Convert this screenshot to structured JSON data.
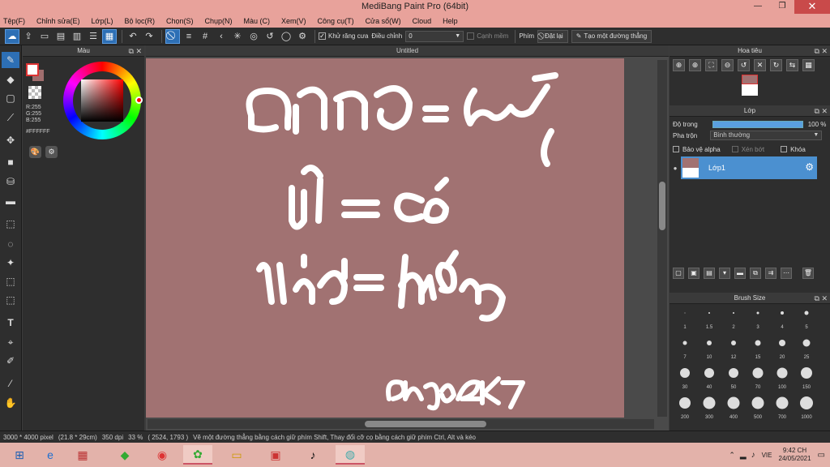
{
  "window": {
    "title": "MediBang Paint Pro (64bit)",
    "min": "—",
    "max": "❐",
    "close": "✕"
  },
  "menu": [
    "Tệp(F)",
    "Chỉnh sửa(E)",
    "Lớp(L)",
    "Bộ lọc(R)",
    "Chọn(S)",
    "Chụp(N)",
    "Màu (C)",
    "Xem(V)",
    "Công cụ(T)",
    "Cửa sổ(W)",
    "Cloud",
    "Help"
  ],
  "toolbar": {
    "antialias_label": "Khử răng cưa",
    "adjust_label": "Điều chỉnh",
    "adjust_value": "0",
    "smooth_label": "Cạnh mềm",
    "key_label": "Phím",
    "reset_label": "Đặt lại",
    "straight_line_label": "Tạo một đường thẳng"
  },
  "color_panel": {
    "title": "Màu",
    "r": "R:255",
    "g": "G:255",
    "b": "B:255",
    "hex": "#FFFFFF",
    "fg_color": "#ffffff",
    "bg_color": "#a06e6e"
  },
  "canvas": {
    "tab_title": "Untitled",
    "bg_color": "#a17272",
    "stroke_color": "#ffffff",
    "text_lines": [
      "= có",
      "= không",
      "ohng2k7"
    ]
  },
  "navigator": {
    "title": "Hoa tiêu"
  },
  "layer_panel": {
    "title": "Lớp",
    "opacity_label": "Độ trong",
    "opacity_value": "100 %",
    "opacity": 100,
    "blend_label": "Pha trộn",
    "blend_value": "Bình thường",
    "protect_alpha": "Bảo vệ alpha",
    "clipping": "Xén bớt",
    "lock": "Khóa",
    "layers": [
      {
        "name": "Lớp1"
      }
    ]
  },
  "brush_size": {
    "title": "Brush Size",
    "sizes": [
      "1",
      "1.5",
      "2",
      "3",
      "4",
      "5",
      "7",
      "10",
      "12",
      "15",
      "20",
      "25",
      "30",
      "40",
      "50",
      "70",
      "100",
      "150",
      "200",
      "300",
      "400",
      "500",
      "700",
      "1000"
    ]
  },
  "status": {
    "size": "3000 * 4000 pixel",
    "cm": "(21.8 * 29cm)",
    "dpi": "350 dpi",
    "zoom": "33 %",
    "coords": "( 2524, 1793 )",
    "hint": "Vẽ một đường thẳng bằng cách giữ phím Shift, Thay đổi cỡ cọ bằng cách giữ phím Ctrl, Alt và kéo"
  },
  "taskbar": {
    "ime": "VIE",
    "time": "9:42 CH",
    "date": "24/05/2021"
  }
}
